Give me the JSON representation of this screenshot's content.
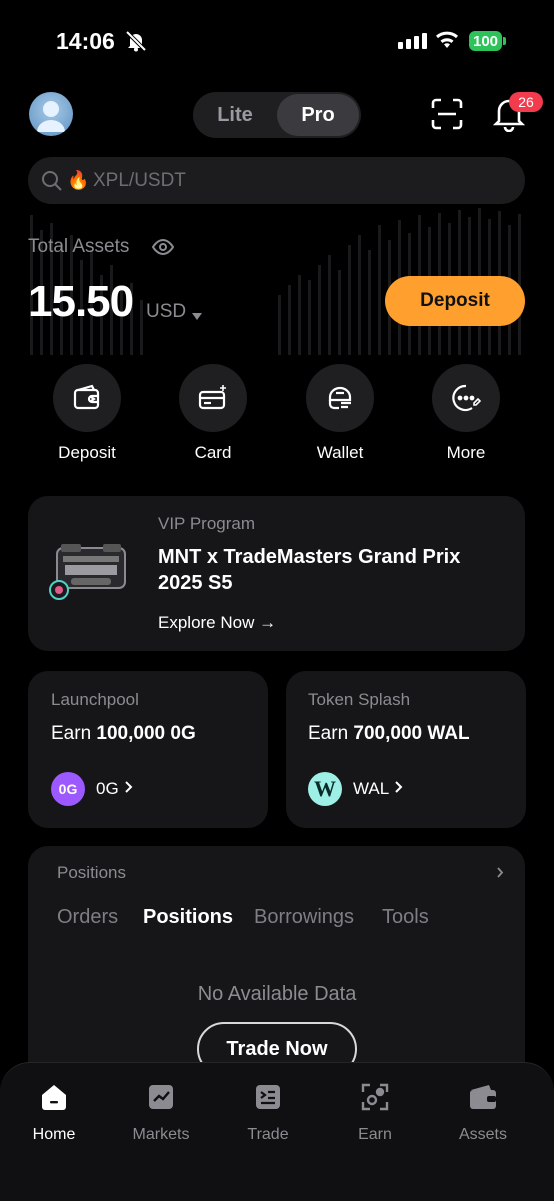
{
  "status_bar": {
    "time": "14:06",
    "battery": "100"
  },
  "header": {
    "mode_toggle": {
      "lite": "Lite",
      "pro": "Pro",
      "selected": "Pro"
    },
    "notification_count": "26"
  },
  "search": {
    "placeholder": "XPL/USDT"
  },
  "assets": {
    "label": "Total Assets",
    "value": "15.50",
    "currency": "USD",
    "deposit_label": "Deposit"
  },
  "quick_actions": [
    {
      "label": "Deposit",
      "icon": "wallet-deposit-icon"
    },
    {
      "label": "Card",
      "icon": "card-icon"
    },
    {
      "label": "Wallet",
      "icon": "web3-wallet-icon"
    },
    {
      "label": "More",
      "icon": "more-icon"
    }
  ],
  "vip_banner": {
    "subtitle": "VIP Program",
    "title": "MNT x TradeMasters Grand Prix 2025 S5",
    "link": "Explore Now →"
  },
  "launchpool": {
    "title": "Launchpool",
    "earn_prefix": "Earn",
    "earn_amount": "100,000 0G",
    "token": "0G",
    "token_color": "#9b59ff"
  },
  "token_splash": {
    "title": "Token Splash",
    "earn_prefix": "Earn",
    "earn_amount": "700,000 WAL",
    "token": "WAL",
    "token_color": "#9ef0e6"
  },
  "positions": {
    "title": "Positions",
    "tabs": [
      "Orders",
      "Positions",
      "Borrowings",
      "Tools"
    ],
    "active_tab": "Positions",
    "empty_text": "No Available Data",
    "action_label": "Trade Now"
  },
  "bottom_nav": [
    {
      "label": "Home",
      "icon": "home-icon",
      "active": true
    },
    {
      "label": "Markets",
      "icon": "markets-icon",
      "active": false
    },
    {
      "label": "Trade",
      "icon": "trade-icon",
      "active": false
    },
    {
      "label": "Earn",
      "icon": "earn-icon",
      "active": false
    },
    {
      "label": "Assets",
      "icon": "assets-icon",
      "active": false
    }
  ],
  "colors": {
    "accent": "#ff9f2e",
    "badge": "#f23c4e",
    "battery": "#2ec25a"
  }
}
